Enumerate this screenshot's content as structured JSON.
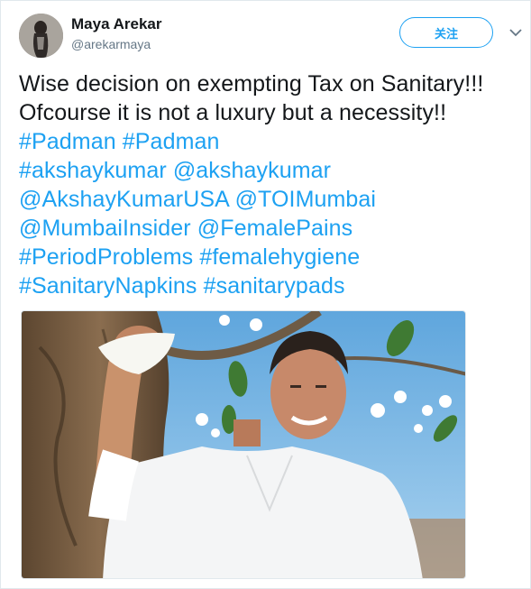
{
  "user": {
    "display_name": "Maya Arekar",
    "handle": "@arekarmaya"
  },
  "follow_button": {
    "label": "关注"
  },
  "tweet": {
    "line1": "Wise decision on exempting Tax on Sanitary!!!",
    "line2": "Ofcourse it is not a luxury but a necessity!!",
    "links": [
      [
        "#Padman",
        "#Padman"
      ],
      [
        "#akshaykumar",
        "@akshaykumar"
      ],
      [
        "@AkshayKumarUSA",
        "@TOIMumbai"
      ],
      [
        "@MumbaiInsider",
        "@FemalePains"
      ],
      [
        "#PeriodProblems",
        "#femalehygiene"
      ],
      [
        "#SanitaryNapkins",
        "#sanitarypads"
      ]
    ]
  },
  "colors": {
    "link": "#1da1f2",
    "text": "#14171a",
    "muted": "#657786"
  },
  "icons": {
    "menu": "chevron-down-icon"
  }
}
